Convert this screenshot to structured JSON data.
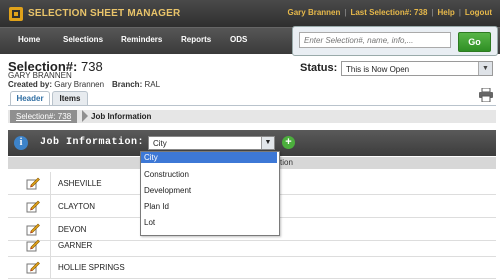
{
  "app": {
    "title": "SELECTION SHEET MANAGER"
  },
  "usermenu": {
    "user": "Gary Brannen",
    "last_selection": "Last Selection#: 738",
    "help": "Help",
    "logout": "Logout"
  },
  "nav": {
    "items": [
      "Home",
      "Selections",
      "Reminders",
      "Reports",
      "ODS"
    ]
  },
  "search": {
    "placeholder": "Enter Selection#, name, info,...",
    "go_label": "Go"
  },
  "selection": {
    "title_label": "Selection#:",
    "number": "738",
    "customer": "GARY BRANNEN",
    "created_by_label": "Created by:",
    "created_by": "Gary Brannen",
    "branch_label": "Branch:",
    "branch": "RAL"
  },
  "status": {
    "label": "Status:",
    "value": "This is Now Open"
  },
  "tabs": [
    {
      "label": "Header"
    },
    {
      "label": "Items"
    }
  ],
  "breadcrumb": {
    "link": "Selection#: 738",
    "current": "Job Information"
  },
  "job": {
    "label": "Job Information:",
    "selected": "City",
    "options": [
      "City",
      "Construction",
      "Development",
      "Plan Id",
      "Lot"
    ]
  },
  "table": {
    "description_header_fragment": "tion",
    "rows": [
      "ASHEVILLE",
      "CLAYTON",
      "DEVON",
      "GARNER",
      "HOLLIE SPRINGS"
    ]
  },
  "colors": {
    "accent_gold": "#e9c46a",
    "go_green": "#2f8f24",
    "highlight_blue": "#3d78d6"
  },
  "icons": [
    "logo-icon",
    "info-icon",
    "add-icon",
    "printer-icon",
    "edit-pencil-icon",
    "dropdown-arrow-icon"
  ]
}
